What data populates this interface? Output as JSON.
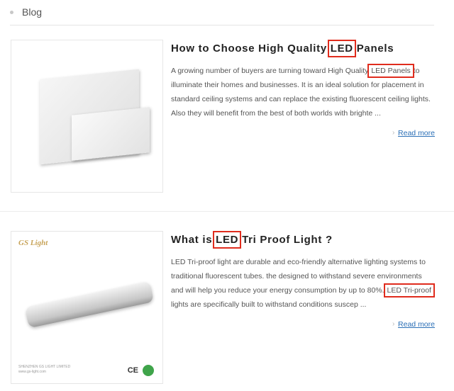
{
  "breadcrumb": {
    "label": "Blog"
  },
  "posts": [
    {
      "title_pre": "How to Choose High Quality ",
      "title_hl": "LED",
      "title_post": " Panels",
      "excerpt_pre": "A growing number of buyers are turning toward High Quality ",
      "excerpt_hl": "LED Panels",
      "excerpt_post": " to illuminate their homes and businesses. It is an ideal solution for placement in standard ceiling systems and can replace the existing fluorescent ceiling lights. Also they will benefit from the best of both worlds with brighte ...",
      "read_more": "Read more",
      "thumb_icon": "led-panel-image"
    },
    {
      "title_pre": "What is ",
      "title_hl": "LED",
      "title_post": " Tri Proof Light ?",
      "excerpt_pre": "LED Tri-proof light are durable and eco-friendly alternative lighting systems to traditional fluorescent tubes. the designed to withstand severe environments and will help you reduce your energy consumption by up to 80%. ",
      "excerpt_hl": "LED Tri-proof",
      "excerpt_post": " lights are specifically built to withstand conditions suscep ...",
      "read_more": "Read more",
      "thumb_icon": "tri-proof-light-image",
      "logo_text": "GS Light",
      "footer_line1": "SHENZHEN GS LIGHT LIMITED",
      "footer_line2": "www.gs-light.com",
      "ce_mark": "CE"
    }
  ],
  "colors": {
    "highlight": "#e02c1d",
    "link": "#2b6fb6"
  }
}
